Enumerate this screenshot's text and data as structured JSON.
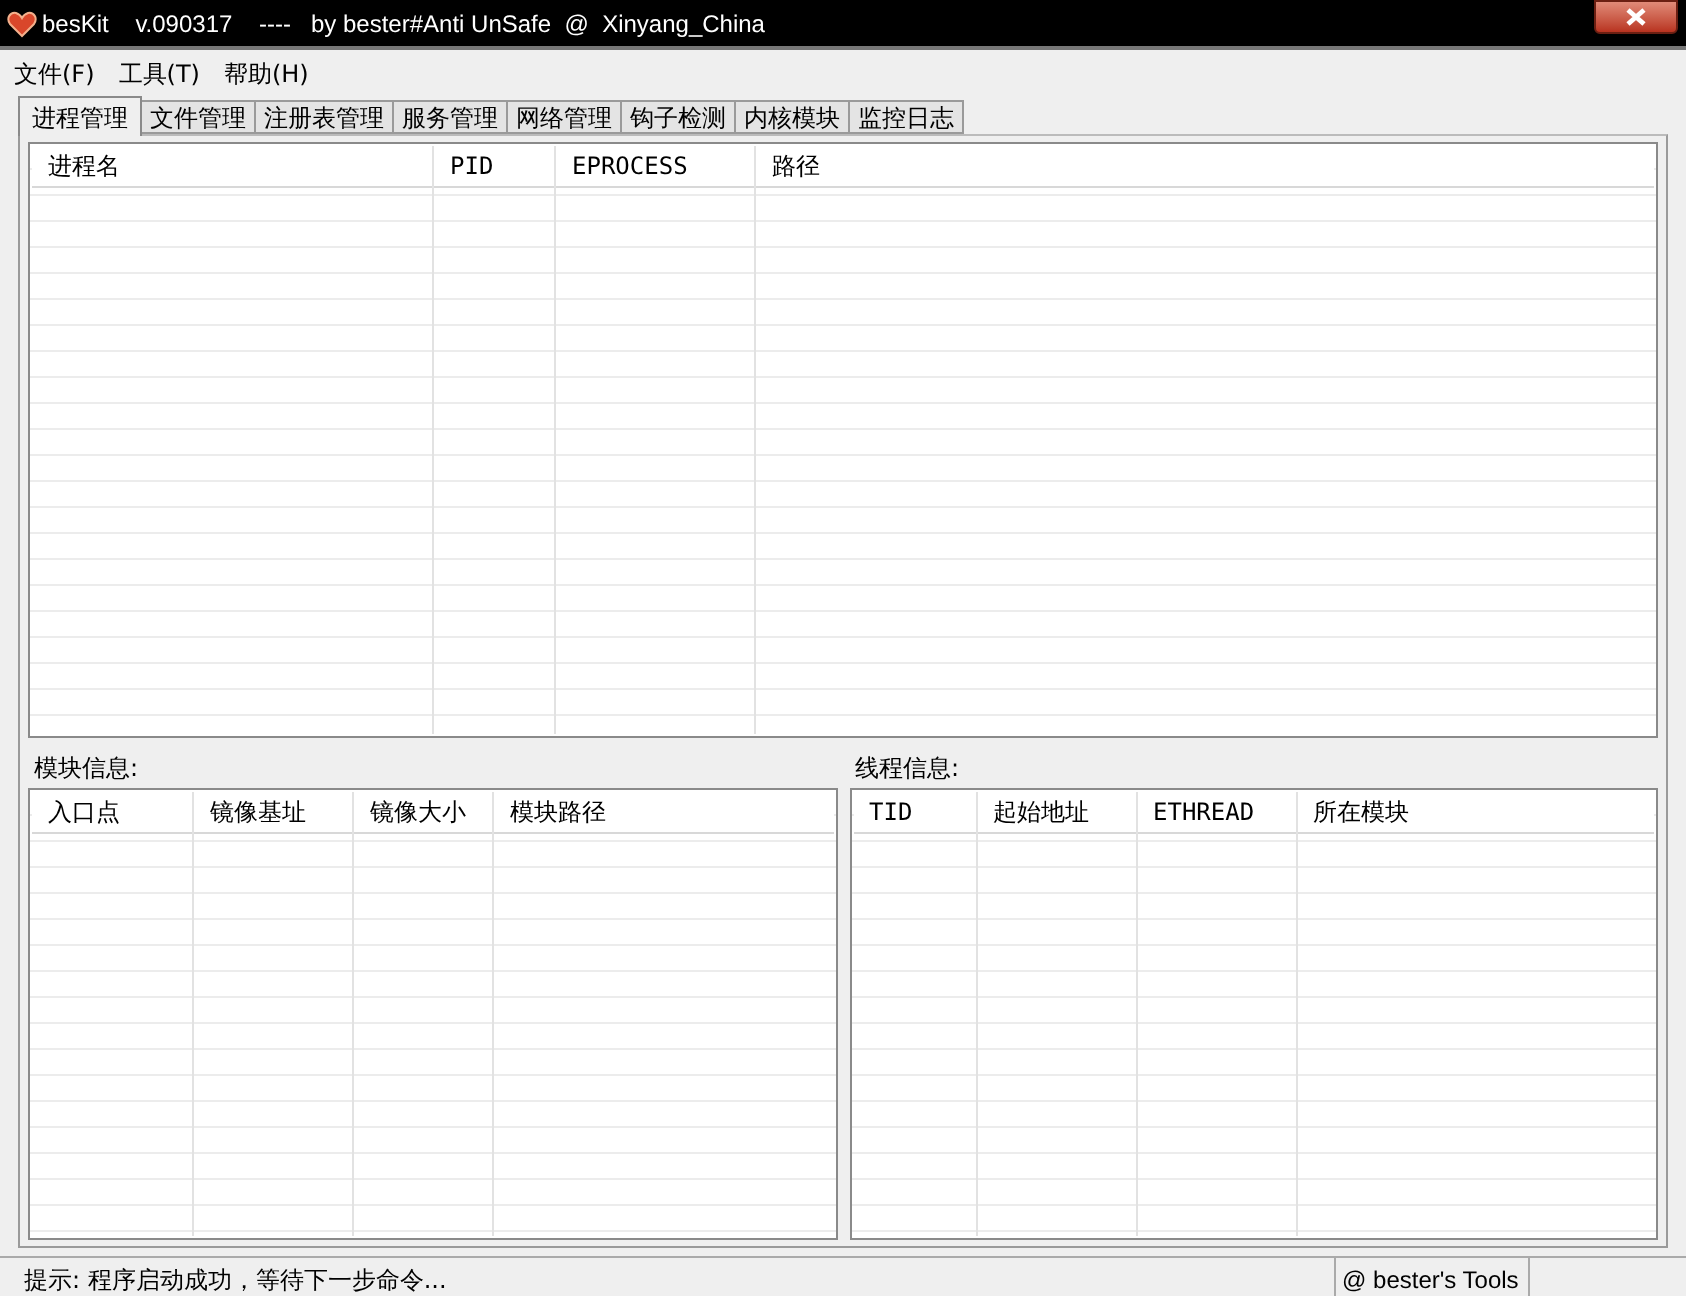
{
  "window": {
    "title": "besKit    v.090317    ----   by bester#Anti UnSafe  @  Xinyang_China"
  },
  "menu": [
    "文件(F)",
    "工具(T)",
    "帮助(H)"
  ],
  "tabs": [
    {
      "label": "进程管理",
      "selected": true
    },
    {
      "label": "文件管理",
      "selected": false
    },
    {
      "label": "注册表管理",
      "selected": false
    },
    {
      "label": "服务管理",
      "selected": false
    },
    {
      "label": "网络管理",
      "selected": false
    },
    {
      "label": "钩子检测",
      "selected": false
    },
    {
      "label": "内核模块",
      "selected": false
    },
    {
      "label": "监控日志",
      "selected": false
    }
  ],
  "process_table": {
    "columns": [
      "进程名",
      "PID",
      "EPROCESS",
      "路径"
    ]
  },
  "module_panel": {
    "label": "模块信息:",
    "columns": [
      "入口点",
      "镜像基址",
      "镜像大小",
      "模块路径"
    ]
  },
  "thread_panel": {
    "label": "线程信息:",
    "columns": [
      "TID",
      "起始地址",
      "ETHREAD",
      "所在模块"
    ]
  },
  "status_bar": {
    "message": "提示:  程序启动成功，等待下一步命令...",
    "credit": "@ bester's Tools"
  }
}
